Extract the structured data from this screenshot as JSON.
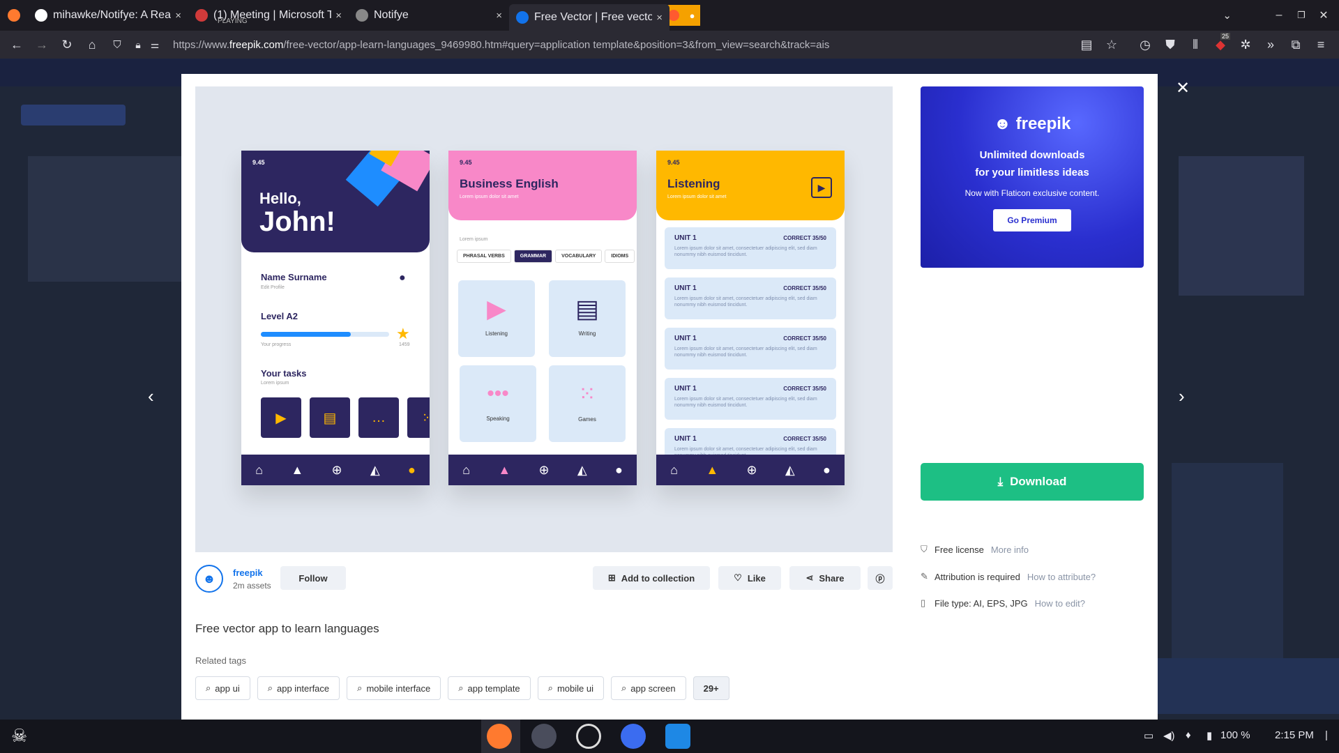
{
  "browser": {
    "tabs": [
      {
        "label": "mihawke/Notifye: A React",
        "close": "×"
      },
      {
        "label": "(1) Meeting | Microsoft Te",
        "sub": "PLAYING",
        "close": "×"
      },
      {
        "label": "Notifye",
        "close": "×"
      },
      {
        "label": "Free Vector | Free vector a",
        "close": "×"
      }
    ],
    "url_prefix": "https://www.",
    "url_domain": "freepik.com",
    "url_rest": "/free-vector/app-learn-languages_9469980.htm#query=application template&position=3&from_view=search&track=ais",
    "badge": "25"
  },
  "preview": {
    "phone1": {
      "time": "9.45",
      "greeting1": "Hello,",
      "greeting2": "John!",
      "name": "Name Surname",
      "edit": "Edit Profile",
      "level": "Level A2",
      "progress_label": "Your progress",
      "progress": 0.7,
      "points": "1459",
      "tasks_title": "Your tasks",
      "tasks_sub": "Lorem ipsum"
    },
    "phone2": {
      "time": "9.45",
      "title": "Business English",
      "sub": "Lorem ipsum dolor sit amet",
      "lorem": "Lorem ipsum",
      "chips": [
        "PHRASAL VERBS",
        "GRAMMAR",
        "VOCABULARY",
        "IDIOMS"
      ],
      "cards": [
        "Listening",
        "Writing",
        "Speaking",
        "Games"
      ]
    },
    "phone3": {
      "time": "9.45",
      "title": "Listening",
      "sub": "Lorem ipsum dolor sit amet",
      "units": [
        {
          "name": "UNIT 1",
          "score": "CORRECT 35/50",
          "text": "Lorem ipsum dolor sit amet, consectetuer adipiscing elit, sed diam nonummy nibh euismod tincidunt."
        },
        {
          "name": "UNIT 1",
          "score": "CORRECT 35/50",
          "text": "Lorem ipsum dolor sit amet, consectetuer adipiscing elit, sed diam nonummy nibh euismod tincidunt."
        },
        {
          "name": "UNIT 1",
          "score": "CORRECT 35/50",
          "text": "Lorem ipsum dolor sit amet, consectetuer adipiscing elit, sed diam nonummy nibh euismod tincidunt."
        },
        {
          "name": "UNIT 1",
          "score": "CORRECT 35/50",
          "text": "Lorem ipsum dolor sit amet, consectetuer adipiscing elit, sed diam nonummy nibh euismod tincidunt."
        },
        {
          "name": "UNIT 1",
          "score": "CORRECT 35/50",
          "text": "Lorem ipsum dolor sit amet, consectetuer adipiscing elit, sed diam nonummy nibh euismod tincidunt."
        }
      ]
    }
  },
  "ad": {
    "logo": "freepik",
    "line1": "Unlimited downloads",
    "line2": "for your limitless ideas",
    "line3": "Now with Flaticon exclusive content.",
    "button": "Go Premium"
  },
  "download": {
    "label": "Download"
  },
  "info": [
    {
      "label": "Free license",
      "link": "More info"
    },
    {
      "label": "Attribution is required",
      "link": "How to attribute?"
    },
    {
      "label": "File type: AI, EPS, JPG",
      "link": "How to edit?"
    }
  ],
  "author": {
    "name": "freepik",
    "assets": "2m assets",
    "follow": "Follow"
  },
  "actions": {
    "add": "Add to collection",
    "like": "Like",
    "share": "Share"
  },
  "title": "Free vector app to learn languages",
  "related_label": "Related tags",
  "tags": [
    "app ui",
    "app interface",
    "mobile interface",
    "app template",
    "mobile ui",
    "app screen"
  ],
  "tags_more": "29+",
  "taskbar": {
    "battery": "100 %",
    "time": "2:15 PM"
  },
  "colors": {
    "download": "#1dbf84",
    "navy": "#2d2660",
    "pink": "#f888c8",
    "yellow": "#ffb800"
  }
}
